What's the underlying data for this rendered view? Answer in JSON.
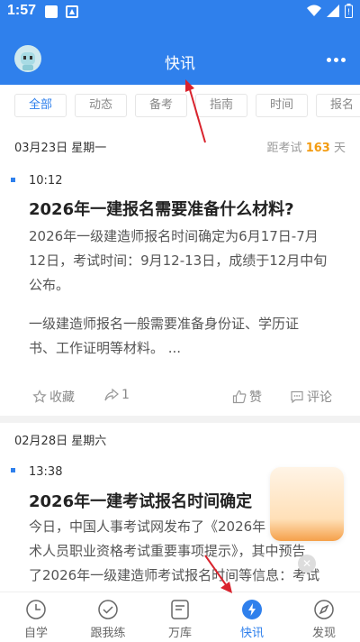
{
  "status_bar": {
    "time": "1:57"
  },
  "header": {
    "title": "快讯"
  },
  "filters": [
    "全部",
    "动态",
    "备考",
    "指南",
    "时间",
    "报名"
  ],
  "countdown": {
    "prefix": "距考试",
    "days": "163",
    "suffix": "天"
  },
  "posts": [
    {
      "date": "03月23日  星期一",
      "time": "10:12",
      "title": "2026年一建报名需要准备什么材料?",
      "paragraphs": [
        [
          "2026年一级建造师报名时间确定为6月17日-7月",
          "12日，考试时间：9月12-13日，成绩于12月中旬",
          "公布。"
        ],
        [
          "一级建造师报名一般需要准备身份证、学历证",
          "书、工作证明等材料。 ..."
        ]
      ],
      "actions": {
        "favorite": "收藏",
        "share": "1",
        "like": "赞",
        "comment": "评论"
      }
    },
    {
      "date": "02月28日  星期六",
      "time": "13:38",
      "title": "2026年一建考试报名时间确定",
      "paragraphs": [
        [
          "今日，中国人事考试网发布了《2026年",
          "术人员职业资格考试重要事项提示》，其中预告",
          "了2026年一级建造师考试报名时间等信息：考试"
        ]
      ]
    }
  ],
  "tabs": [
    "自学",
    "跟我练",
    "万库",
    "快讯",
    "发现"
  ],
  "colors": {
    "primary": "#2f80ec",
    "accent": "#f39c12",
    "arrow": "#d9232d"
  }
}
